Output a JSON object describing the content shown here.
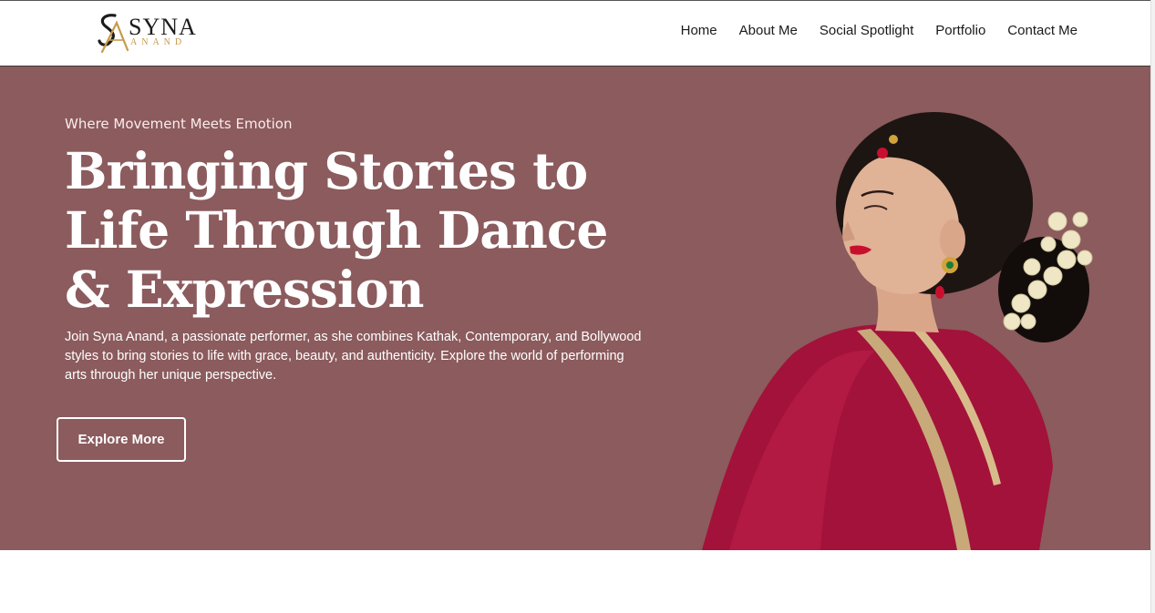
{
  "brand": {
    "name": "SYNA",
    "surname": "ANAND",
    "monogram": "SA",
    "accent_color": "#c89a4a"
  },
  "nav": {
    "items": [
      {
        "label": "Home"
      },
      {
        "label": "About Me"
      },
      {
        "label": "Social Spotlight"
      },
      {
        "label": "Portfolio"
      },
      {
        "label": "Contact Me"
      }
    ]
  },
  "hero": {
    "background_color": "#8b5b5d",
    "tagline": "Where Movement Meets Emotion",
    "headline_lines": [
      "Bringing Stories to",
      "Life Through Dance",
      "& Expression"
    ],
    "description": "Join Syna Anand, a passionate performer, as she combines Kathak, Contemporary, and Bollywood styles to bring stories to life with grace, beauty, and authenticity. Explore the world of performing arts through her unique perspective.",
    "cta_label": "Explore More",
    "image": "dancer-portrait-image"
  }
}
